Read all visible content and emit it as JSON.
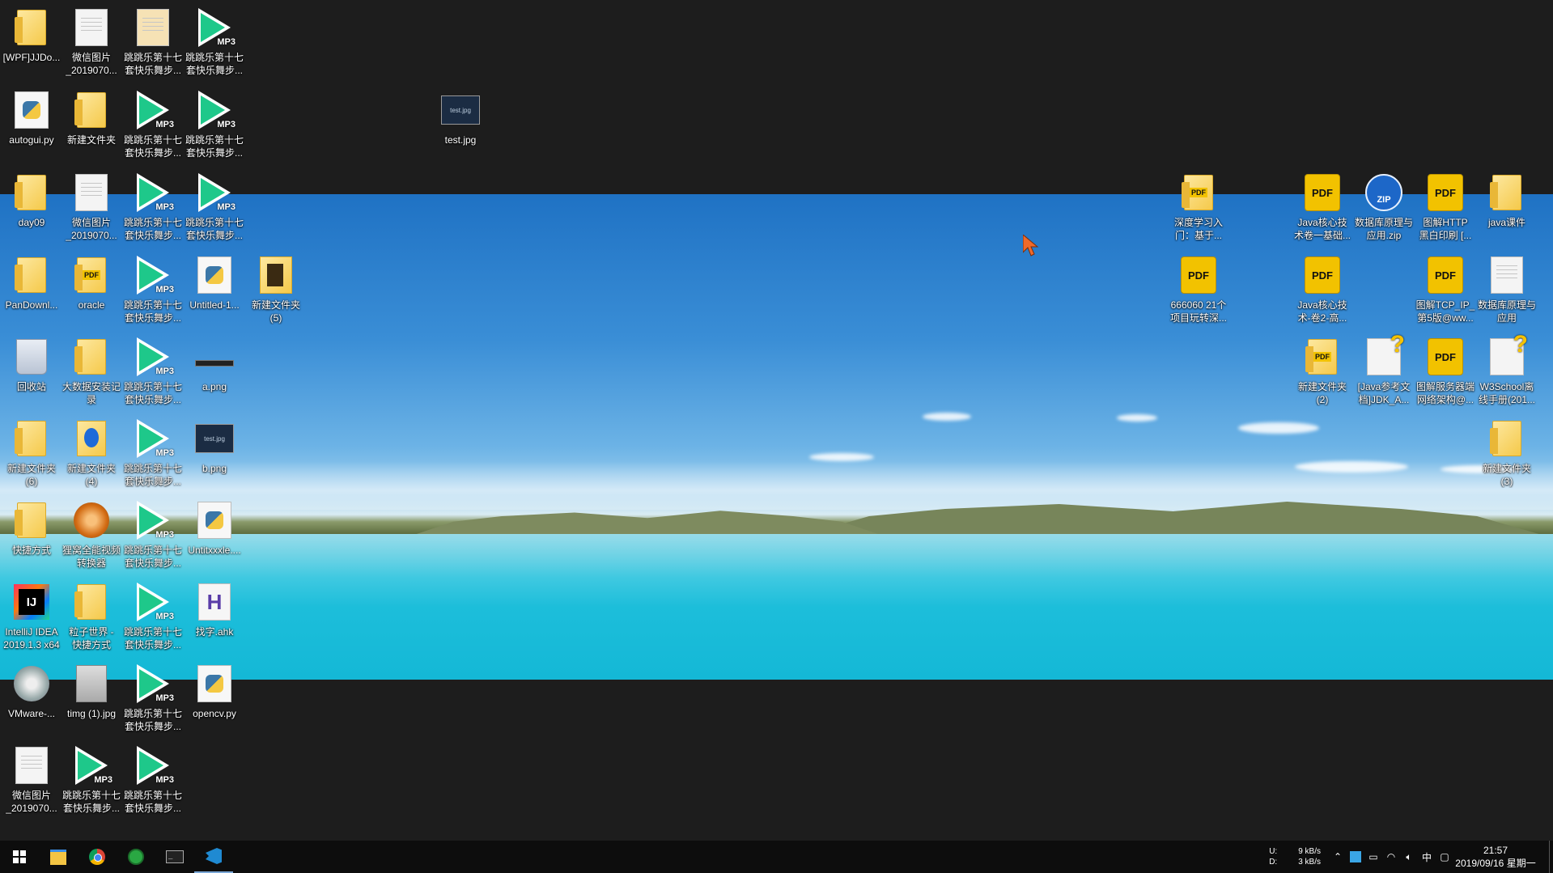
{
  "desktop": {
    "icons": [
      {
        "id": "wpf",
        "label": "[WPF]JJDo...",
        "type": "folder"
      },
      {
        "id": "wx1",
        "label": "微信图片\n_2019070...",
        "type": "doc"
      },
      {
        "id": "mp3a",
        "label": "跳跳乐第十七\n套快乐舞步...",
        "type": "image-folder"
      },
      {
        "id": "mp3b",
        "label": "跳跳乐第十七\n套快乐舞步...",
        "type": "mp3"
      },
      {
        "id": "autogui",
        "label": "autogui.py",
        "type": "py"
      },
      {
        "id": "newfolder",
        "label": "新建文件夹",
        "type": "folder"
      },
      {
        "id": "mp3c",
        "label": "跳跳乐第十七\n套快乐舞步...",
        "type": "mp3"
      },
      {
        "id": "mp3d",
        "label": "跳跳乐第十七\n套快乐舞步...",
        "type": "mp3"
      },
      {
        "id": "testjpg",
        "label": "test.jpg",
        "type": "img"
      },
      {
        "id": "day09",
        "label": "day09",
        "type": "folder"
      },
      {
        "id": "wx2",
        "label": "微信图片\n_2019070...",
        "type": "doc"
      },
      {
        "id": "mp3e",
        "label": "跳跳乐第十七\n套快乐舞步...",
        "type": "mp3"
      },
      {
        "id": "mp3f",
        "label": "跳跳乐第十七\n套快乐舞步...",
        "type": "mp3"
      },
      {
        "id": "pandownl",
        "label": "PanDownl...",
        "type": "folder"
      },
      {
        "id": "oracle",
        "label": "oracle",
        "type": "pdf-folder"
      },
      {
        "id": "mp3g",
        "label": "跳跳乐第十七\n套快乐舞步...",
        "type": "mp3"
      },
      {
        "id": "untitled1",
        "label": "Untitled-1...",
        "type": "py"
      },
      {
        "id": "newfolder5",
        "label": "新建文件夹\n(5)",
        "type": "dvd"
      },
      {
        "id": "recycle",
        "label": "回收站",
        "type": "recycle"
      },
      {
        "id": "bigdata",
        "label": "大数据安装记\n录",
        "type": "folder"
      },
      {
        "id": "mp3h",
        "label": "跳跳乐第十七\n套快乐舞步...",
        "type": "mp3"
      },
      {
        "id": "apng",
        "label": "a.png",
        "type": "img-thin"
      },
      {
        "id": "newfolder6",
        "label": "新建文件夹\n(6)",
        "type": "folder"
      },
      {
        "id": "newfolder4",
        "label": "新建文件夹\n(4)",
        "type": "bluefolder"
      },
      {
        "id": "mp3i",
        "label": "跳跳乐第十七\n套快乐舞步...",
        "type": "mp3"
      },
      {
        "id": "bpng",
        "label": "b.png",
        "type": "img"
      },
      {
        "id": "shortcut",
        "label": "快捷方式",
        "type": "folder"
      },
      {
        "id": "video",
        "label": "狸窝全能视频\n转换器",
        "type": "video"
      },
      {
        "id": "mp3j",
        "label": "跳跳乐第十七\n套快乐舞步...",
        "type": "mp3"
      },
      {
        "id": "untitxx",
        "label": "Untitxxxle....",
        "type": "py"
      },
      {
        "id": "idea",
        "label": "IntelliJ IDEA\n2019.1.3 x64",
        "type": "ij"
      },
      {
        "id": "particle",
        "label": "粒子世界 -\n快捷方式",
        "type": "folder"
      },
      {
        "id": "mp3k",
        "label": "跳跳乐第十七\n套快乐舞步...",
        "type": "mp3"
      },
      {
        "id": "ahk",
        "label": "找字.ahk",
        "type": "h"
      },
      {
        "id": "vmware",
        "label": "VMware-...",
        "type": "vm"
      },
      {
        "id": "timg",
        "label": "timg (1).jpg",
        "type": "photo"
      },
      {
        "id": "mp3l",
        "label": "跳跳乐第十七\n套快乐舞步...",
        "type": "mp3"
      },
      {
        "id": "opencv",
        "label": "opencv.py",
        "type": "py"
      },
      {
        "id": "wx3",
        "label": "微信图片\n_2019070...",
        "type": "doc"
      },
      {
        "id": "mp3m",
        "label": "跳跳乐第十七\n套快乐舞步...",
        "type": "mp3"
      },
      {
        "id": "mp3n",
        "label": "跳跳乐第十七\n套快乐舞步...",
        "type": "mp3"
      },
      {
        "id": "dl",
        "label": "深度学习入\n门：基于...",
        "type": "pdf-folder"
      },
      {
        "id": "java1",
        "label": "Java核心技\n术卷一基础...",
        "type": "pdf"
      },
      {
        "id": "dbzip",
        "label": "数据库原理与\n应用.zip",
        "type": "zip"
      },
      {
        "id": "http",
        "label": "图解HTTP\n黑白印刷 [...",
        "type": "pdf"
      },
      {
        "id": "javakj",
        "label": "java课件",
        "type": "folder"
      },
      {
        "id": "p666",
        "label": "666060 21个\n项目玩转深...",
        "type": "pdf"
      },
      {
        "id": "java2",
        "label": "Java核心技\n术-卷2-高...",
        "type": "pdf"
      },
      {
        "id": "tcp",
        "label": "图解TCP_IP_\n第5版@ww...",
        "type": "pdf"
      },
      {
        "id": "dbapp",
        "label": "数据库原理与\n应用",
        "type": "doc"
      },
      {
        "id": "newfolder2",
        "label": "新建文件夹\n(2)",
        "type": "pdf-folder"
      },
      {
        "id": "jdk",
        "label": "[Java参考文\n档]JDK_A...",
        "type": "help"
      },
      {
        "id": "server",
        "label": "图解服务器端\n网络架构@...",
        "type": "pdf"
      },
      {
        "id": "w3c",
        "label": "W3School离\n线手册(201...",
        "type": "help"
      },
      {
        "id": "newfolder3",
        "label": "新建文件夹\n(3)",
        "type": "folder"
      }
    ],
    "mp3_tag": "MP3",
    "pdf_tag": "PDF",
    "zip_tag": "ZIP",
    "img_thumb_text": "test.jpg"
  },
  "taskbar": {
    "start": "start-button",
    "apps": [
      "file-explorer",
      "chrome",
      "green-app",
      "terminal",
      "vscode"
    ],
    "net": {
      "u_label": "U:",
      "d_label": "D:",
      "up": "9 kB/s",
      "down": "3 kB/s"
    },
    "ime": "中",
    "time": "21:57",
    "date": "2019/09/16 星期一"
  }
}
